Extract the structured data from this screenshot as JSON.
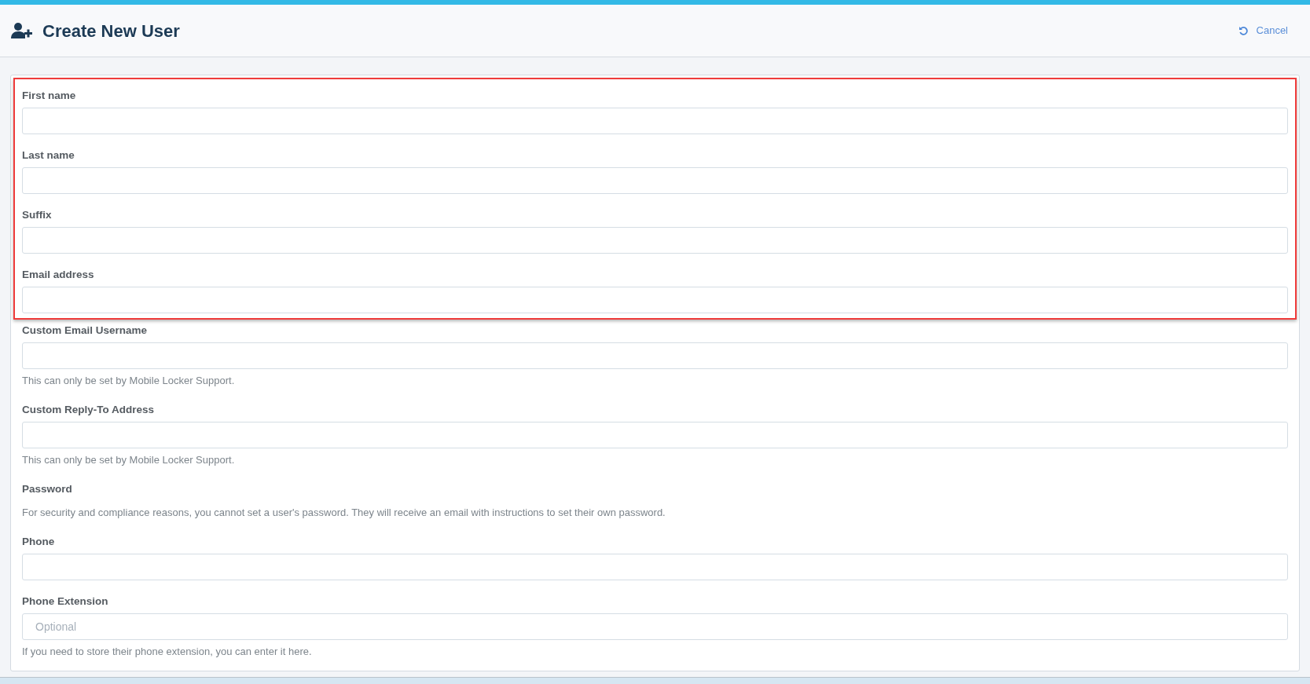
{
  "header": {
    "title": "Create New User",
    "cancel": "Cancel"
  },
  "highlighted_fields": [
    {
      "kind": "input",
      "label": "First name"
    },
    {
      "kind": "input",
      "label": "Last name"
    },
    {
      "kind": "input",
      "label": "Suffix"
    },
    {
      "kind": "input",
      "label": "Email address"
    }
  ],
  "fields": [
    {
      "kind": "input",
      "label": "Custom Email Username",
      "help": "This can only be set by Mobile Locker Support."
    },
    {
      "kind": "input",
      "label": "Custom Reply-To Address",
      "help": "This can only be set by Mobile Locker Support."
    },
    {
      "kind": "text",
      "label": "Password",
      "help": "For security and compliance reasons, you cannot set a user's password. They will receive an email with instructions to set their own password."
    },
    {
      "kind": "input",
      "label": "Phone"
    },
    {
      "kind": "input",
      "label": "Phone Extension",
      "placeholder": "Optional",
      "help": "If you need to store their phone extension, you can enter it here."
    }
  ]
}
